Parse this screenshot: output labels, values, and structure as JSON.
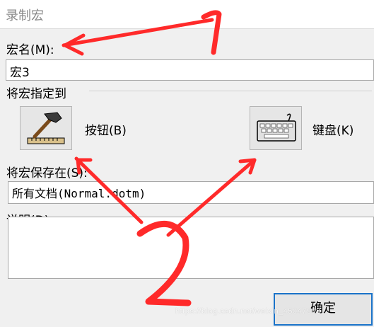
{
  "dialog": {
    "title": "录制宏"
  },
  "macro_name": {
    "label": "宏名(M):",
    "value": "宏3"
  },
  "assign": {
    "label": "将宏指定到",
    "button_label": "按钮(B)",
    "keyboard_label": "键盘(K)"
  },
  "store": {
    "label": "将宏保存在(S):",
    "value": "所有文档(Normal.dotm)"
  },
  "description": {
    "label": "说明(D):",
    "value": ""
  },
  "actions": {
    "ok_label": "确定"
  },
  "annotations": {
    "number_1": "1",
    "number_2": "2",
    "color": "#ff2a2a"
  },
  "watermark": "https://blog.csdn.net/weixin_45047908",
  "icons": [
    "hammer-ruler-icon",
    "keyboard-icon"
  ]
}
